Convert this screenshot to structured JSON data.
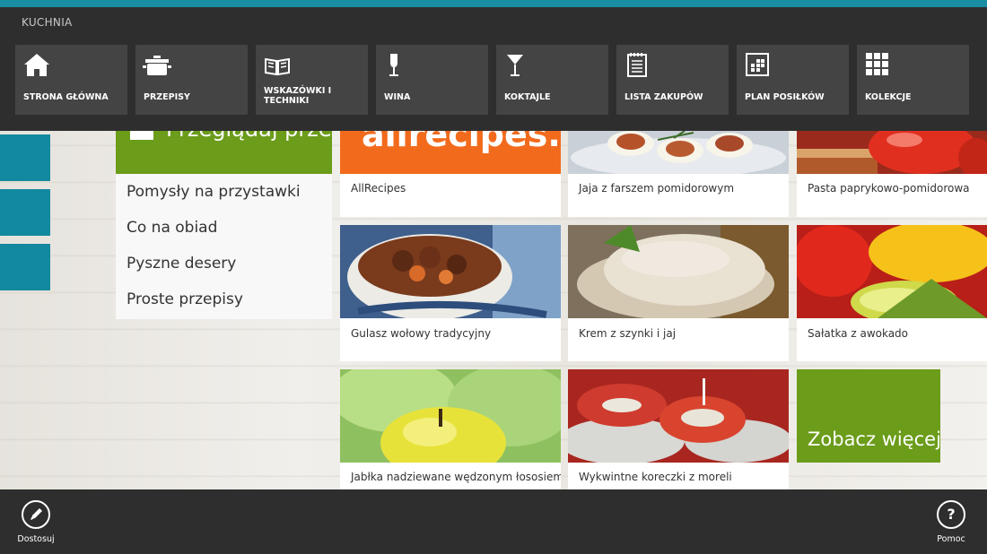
{
  "app": {
    "title": "KUCHNIA"
  },
  "colors": {
    "accent": "#1a8ea3",
    "green": "#6b9c1a",
    "teal": "#12899e",
    "dark": "#2e2e2e",
    "tile": "#444444"
  },
  "nav": {
    "items": [
      {
        "label": "STRONA GŁÓWNA",
        "icon": "home-icon"
      },
      {
        "label": "PRZEPISY",
        "icon": "pot-icon"
      },
      {
        "label": "WSKAZÓWKI I TECHNIKI",
        "icon": "book-icon"
      },
      {
        "label": "WINA",
        "icon": "wine-glass-icon"
      },
      {
        "label": "KOKTAJLE",
        "icon": "cocktail-icon"
      },
      {
        "label": "LISTA ZAKUPÓW",
        "icon": "notepad-icon"
      },
      {
        "label": "PLAN POSIŁKÓW",
        "icon": "calendar-grid-icon"
      },
      {
        "label": "KOLEKCJE",
        "icon": "collection-grid-icon"
      }
    ]
  },
  "browse": {
    "header": "Przeglądaj przepisy",
    "items": [
      "Pomysły na przystawki",
      "Co na obiad",
      "Pyszne desery",
      "Proste przepisy"
    ]
  },
  "recipes": [
    {
      "caption": "AllRecipes",
      "logo": "allrecipes.com"
    },
    {
      "caption": "Jaja z farszem pomidorowym"
    },
    {
      "caption": "Pasta paprykowo-pomidorowa"
    },
    {
      "caption": "Gulasz wołowy tradycyjny"
    },
    {
      "caption": "Krem z szynki i jaj"
    },
    {
      "caption": "Sałatka z awokado"
    },
    {
      "caption": "Jabłka nadziewane wędzonym łososiem"
    },
    {
      "caption": "Wykwintne koreczki z moreli"
    }
  ],
  "more": {
    "label": "Zobacz więcej"
  },
  "appbar": {
    "customize": {
      "label": "Dostosuj",
      "icon": "pencil-icon"
    },
    "help": {
      "label": "Pomoc",
      "icon": "question-icon",
      "glyph": "?"
    }
  }
}
